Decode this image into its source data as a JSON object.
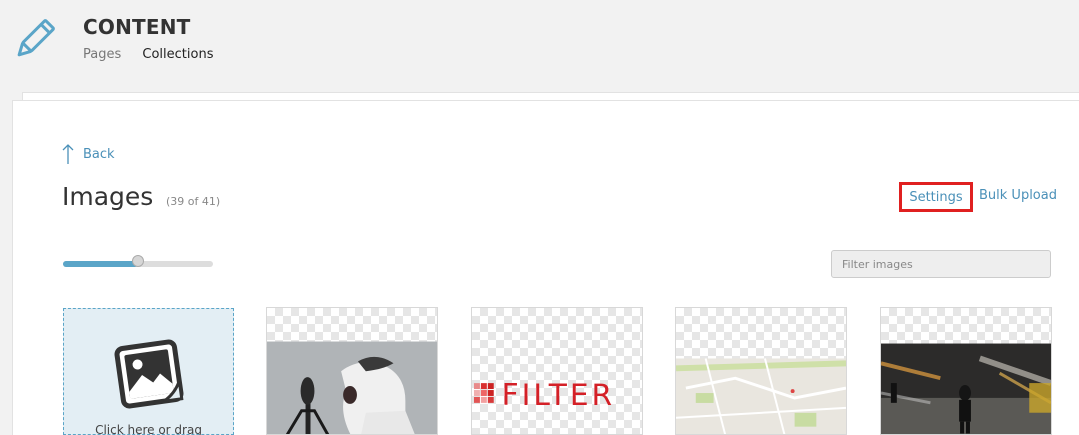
{
  "header": {
    "title": "CONTENT",
    "nav": [
      {
        "label": "Pages"
      },
      {
        "label": "Collections"
      }
    ],
    "icon": "pencil-icon",
    "accent_color": "#5aa5c8"
  },
  "back": {
    "label": "Back",
    "icon": "arrow-up-icon"
  },
  "images": {
    "title": "Images",
    "count": "(39 of 41)"
  },
  "actions": {
    "settings_label": "Settings",
    "bulk_upload_label": "Bulk Upload",
    "highlight_color": "#e02020"
  },
  "size_slider": {
    "value": 0.5
  },
  "filter": {
    "placeholder": "Filter images",
    "value": ""
  },
  "upload": {
    "label": "Click here or drag",
    "icon": "image-upload-icon"
  },
  "thumbnails": [
    {
      "name": "microphone-boy-photo"
    },
    {
      "name": "filter-logo",
      "text": "FILTER"
    },
    {
      "name": "street-map"
    },
    {
      "name": "street-night-photo"
    }
  ]
}
